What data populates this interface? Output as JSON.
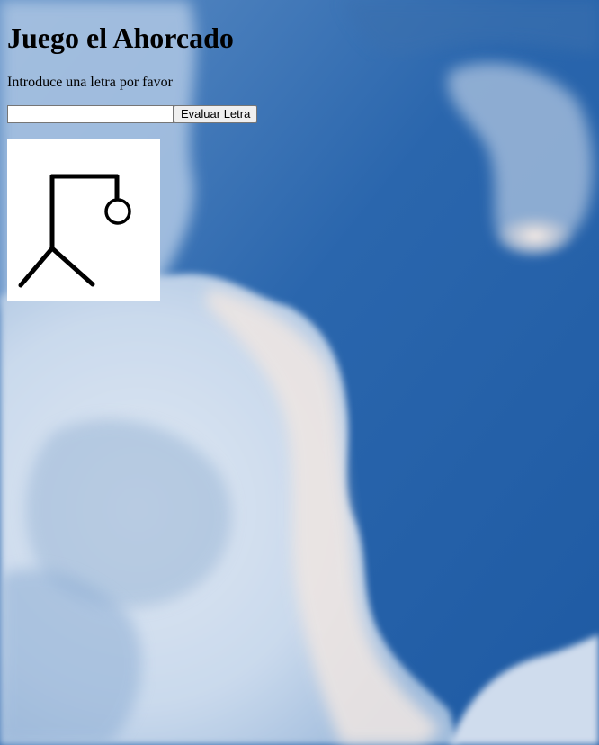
{
  "page": {
    "title": "Juego el Ahorcado",
    "prompt": "Introduce una letra por favor"
  },
  "form": {
    "input_value": "",
    "input_placeholder": "",
    "submit_label": "Evaluar Letra"
  },
  "hangman": {
    "stage_parts": [
      "base",
      "post",
      "beam",
      "rope",
      "head"
    ],
    "stroke_color": "#000000"
  },
  "background": {
    "sky_blue": "#2f6fb3",
    "sky_deep": "#1f5da6",
    "cloud_white": "#f3ebe6"
  }
}
